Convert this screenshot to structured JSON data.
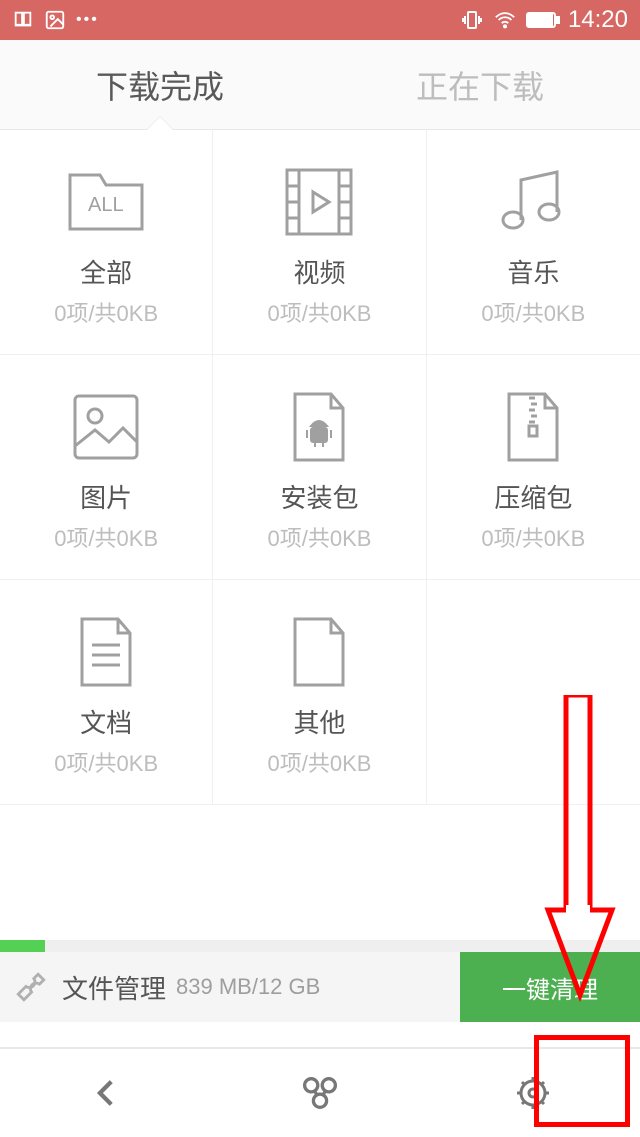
{
  "status": {
    "time": "14:20"
  },
  "tabs": {
    "completed": "下载完成",
    "downloading": "正在下载"
  },
  "cells": {
    "all": {
      "title": "全部",
      "sub": "0项/共0KB",
      "badge": "ALL"
    },
    "video": {
      "title": "视频",
      "sub": "0项/共0KB"
    },
    "music": {
      "title": "音乐",
      "sub": "0项/共0KB"
    },
    "image": {
      "title": "图片",
      "sub": "0项/共0KB"
    },
    "apk": {
      "title": "安装包",
      "sub": "0项/共0KB"
    },
    "zip": {
      "title": "压缩包",
      "sub": "0项/共0KB"
    },
    "doc": {
      "title": "文档",
      "sub": "0项/共0KB"
    },
    "other": {
      "title": "其他",
      "sub": "0项/共0KB"
    }
  },
  "storage": {
    "label": "文件管理",
    "size": "839 MB/12 GB",
    "clean": "一键清理"
  }
}
